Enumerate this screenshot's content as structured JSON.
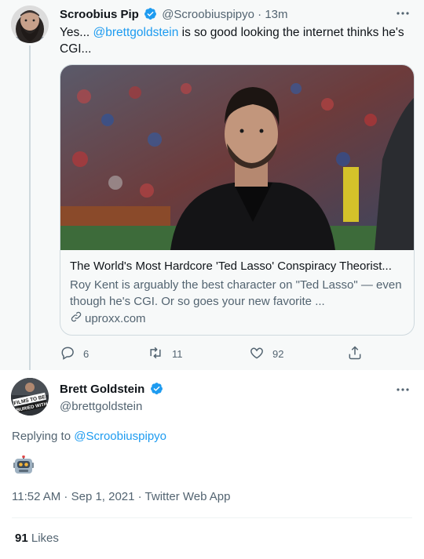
{
  "parent": {
    "author_name": "Scroobius Pip",
    "author_handle": "@Scroobiuspipyo",
    "time": " · 13m",
    "text_before": "Yes... ",
    "mention": "@brettgoldstein",
    "text_after": " is so good looking the internet thinks he's CGI...",
    "card": {
      "title": "The World's Most Hardcore 'Ted Lasso' Conspiracy Theorist...",
      "description": "Roy Kent is arguably the best character on \"Ted Lasso\" — even though he's CGI. Or so goes your new favorite ...",
      "domain": "uproxx.com"
    },
    "actions": {
      "replies": "6",
      "retweets": "11",
      "likes": "92"
    }
  },
  "reply": {
    "author_name": "Brett Goldstein",
    "author_handle": "@brettgoldstein",
    "avatar_text": "FILMS TO BE BURIED WITH",
    "replying_prefix": "Replying to ",
    "replying_to": "@Scroobiuspipyo",
    "emoji": "robot-face",
    "meta": "11:52 AM · Sep 1, 2021 · Twitter Web App",
    "likes_count": "91",
    "likes_label": " Likes"
  },
  "colors": {
    "accent": "#1d9bf0",
    "text": "#0f1419",
    "muted": "#536471",
    "parent_bg": "#f7f9f9"
  }
}
